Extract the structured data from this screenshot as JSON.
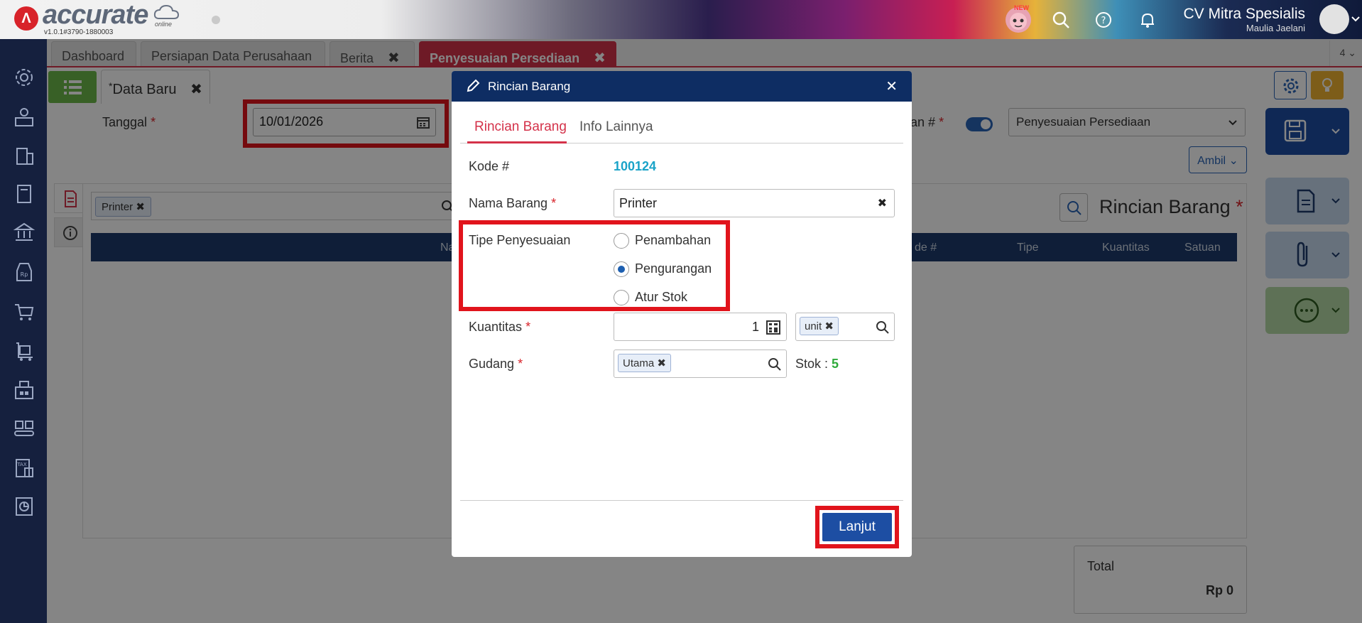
{
  "header": {
    "logo_text": "accurate",
    "logo_online": "online",
    "version": "v1.0.1#3790-1880003",
    "company": "CV Mitra Spesialis",
    "user": "Maulia Jaelani",
    "new_badge": "NEW",
    "icons": [
      "mascot-icon",
      "search-icon",
      "help-icon",
      "bell-icon",
      "avatar",
      "chevron-down-icon"
    ]
  },
  "sidebar": {
    "icons": [
      "gear-icon",
      "user-money-icon",
      "building-icon",
      "book-icon",
      "bank-icon",
      "price-tag-icon",
      "cart-icon",
      "trolley-icon",
      "warehouse-icon",
      "conveyor-icon",
      "tax-icon",
      "report-icon"
    ]
  },
  "tabs": [
    {
      "label": "Dashboard"
    },
    {
      "label": "Persiapan Data Perusahaan"
    },
    {
      "label": "Berita",
      "close": "✖"
    },
    {
      "label": "Penyesuaian Persediaan",
      "close": "✖"
    }
  ],
  "tab_count": "4",
  "subheader": {
    "doc_tab": "Data Baru",
    "doc_tab_prefix": "*",
    "doc_tab_close": "✖"
  },
  "form": {
    "tanggal_label": "Tanggal",
    "tanggal_value": "10/01/2026",
    "no_label": "an #",
    "tipe_value": "Penyesuaian Persediaan",
    "ambil_label": "Ambil"
  },
  "detail": {
    "chip": "Printer",
    "grid_headers": [
      "Na",
      "de #",
      "Tipe",
      "Kuantitas",
      "Satuan"
    ],
    "title": "Rincian Barang",
    "total_label": "Total",
    "total_value": "Rp 0"
  },
  "modal": {
    "title": "Rincian Barang",
    "close": "✕",
    "tabs": [
      "Rincian Barang",
      "Info Lainnya"
    ],
    "kode_label": "Kode #",
    "kode_value": "100124",
    "nama_label": "Nama Barang",
    "nama_value": "Printer",
    "nama_clear": "✖",
    "tipe_label": "Tipe Penyesuaian",
    "tipe_options": [
      "Penambahan",
      "Pengurangan",
      "Atur Stok"
    ],
    "tipe_selected": "Pengurangan",
    "kuantitas_label": "Kuantitas",
    "kuantitas_value": "1",
    "unit_chip": "unit",
    "gudang_label": "Gudang",
    "gudang_chip": "Utama",
    "stok_label": "Stok :",
    "stok_value": "5",
    "chip_close": "✖",
    "submit": "Lanjut"
  },
  "required_mark": "*",
  "colors": {
    "accent_red": "#e1141c",
    "brand_blue": "#0e2d63",
    "active_tab": "#d4324a",
    "stock_green": "#2eaa3a",
    "kode_cyan": "#1aa3c8"
  }
}
